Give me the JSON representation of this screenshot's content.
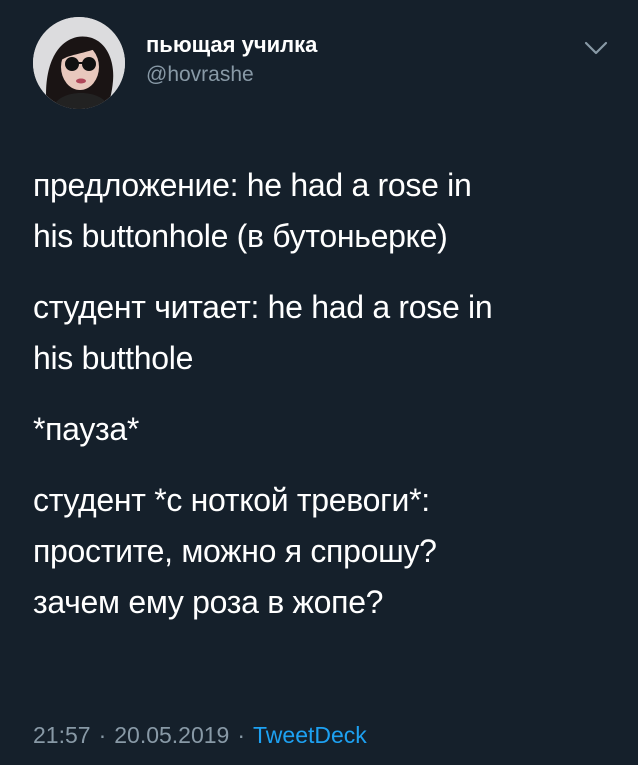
{
  "tweet": {
    "author": {
      "display_name": "пьющая училка",
      "handle": "@hovrashe",
      "avatar_icon": "user-avatar-photo"
    },
    "menu_icon": "chevron-down-icon",
    "paragraphs": [
      "предложение: he had a rose in\nhis buttonhole (в бутоньерке)",
      "студент читает: he had a rose in\nhis butthole",
      "*пауза*",
      "студент *с ноткой тревоги*:\nпростите, можно я спрошу?\nзачем ему роза в жопе?"
    ],
    "meta": {
      "time": "21:57",
      "separator": "·",
      "date": "20.05.2019",
      "source": "TweetDeck"
    }
  },
  "colors": {
    "background": "#15202b",
    "text": "#ffffff",
    "secondary_text": "#8899a6",
    "link": "#1da1f2"
  }
}
